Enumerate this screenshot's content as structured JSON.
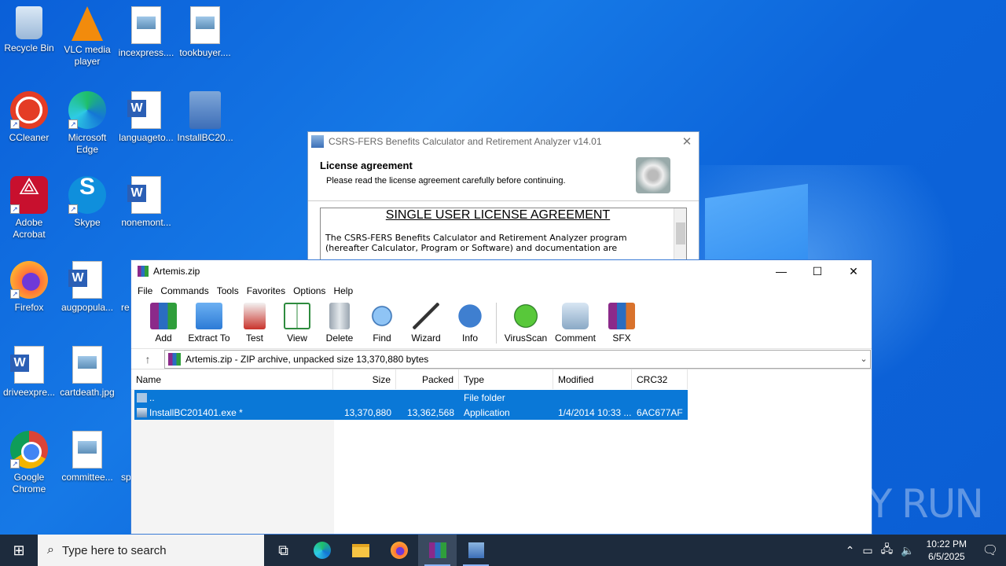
{
  "desktop": {
    "icons": [
      {
        "label": "Recycle Bin",
        "icon": "recycle-bin-icon"
      },
      {
        "label": "VLC media player",
        "icon": "vlc-icon"
      },
      {
        "label": "incexpress....",
        "icon": "image-file-icon"
      },
      {
        "label": "tookbuyer....",
        "icon": "image-file-icon"
      },
      {
        "label": "CCleaner",
        "icon": "ccleaner-icon"
      },
      {
        "label": "Microsoft Edge",
        "icon": "edge-icon"
      },
      {
        "label": "languageto...",
        "icon": "word-doc-icon"
      },
      {
        "label": "InstallBC20...",
        "icon": "installer-icon"
      },
      {
        "label": "Adobe Acrobat",
        "icon": "acrobat-icon"
      },
      {
        "label": "Skype",
        "icon": "skype-icon"
      },
      {
        "label": "nonemont...",
        "icon": "word-doc-icon"
      },
      {
        "label": "Firefox",
        "icon": "firefox-icon"
      },
      {
        "label": "augpopula...",
        "icon": "word-doc-icon"
      },
      {
        "label": "re",
        "icon": "word-doc-icon"
      },
      {
        "label": "driveexpre...",
        "icon": "word-doc-icon"
      },
      {
        "label": "cartdeath.jpg",
        "icon": "image-file-icon"
      },
      {
        "label": "Google Chrome",
        "icon": "chrome-icon"
      },
      {
        "label": "committee...",
        "icon": "image-file-icon"
      },
      {
        "label": "sp",
        "icon": "image-file-icon"
      }
    ]
  },
  "setup": {
    "title": "CSRS-FERS Benefits Calculator and Retirement Analyzer v14.01",
    "heading": "License agreement",
    "subheading": "Please read the license agreement carefully before continuing.",
    "license_title": "SINGLE USER LICENSE AGREEMENT",
    "license_text": "The CSRS-FERS Benefits Calculator and Retirement Analyzer program (hereafter Calculator, Program or Software) and documentation are"
  },
  "rar": {
    "title": "Artemis.zip",
    "menu": [
      "File",
      "Commands",
      "Tools",
      "Favorites",
      "Options",
      "Help"
    ],
    "toolbar": [
      "Add",
      "Extract To",
      "Test",
      "View",
      "Delete",
      "Find",
      "Wizard",
      "Info",
      "VirusScan",
      "Comment",
      "SFX"
    ],
    "address": "Artemis.zip - ZIP archive, unpacked size 13,370,880 bytes",
    "columns": {
      "name": "Name",
      "size": "Size",
      "packed": "Packed",
      "type": "Type",
      "modified": "Modified",
      "crc": "CRC32"
    },
    "rows": [
      {
        "name": "..",
        "size": "",
        "packed": "",
        "type": "File folder",
        "modified": "",
        "crc": ""
      },
      {
        "name": "InstallBC201401.exe *",
        "size": "13,370,880",
        "packed": "13,362,568",
        "type": "Application",
        "modified": "1/4/2014 10:33 ...",
        "crc": "6AC677AF"
      }
    ]
  },
  "watermark": "ANY RUN",
  "taskbar": {
    "search_placeholder": "Type here to search",
    "time": "10:22 PM",
    "date": "6/5/2025"
  }
}
